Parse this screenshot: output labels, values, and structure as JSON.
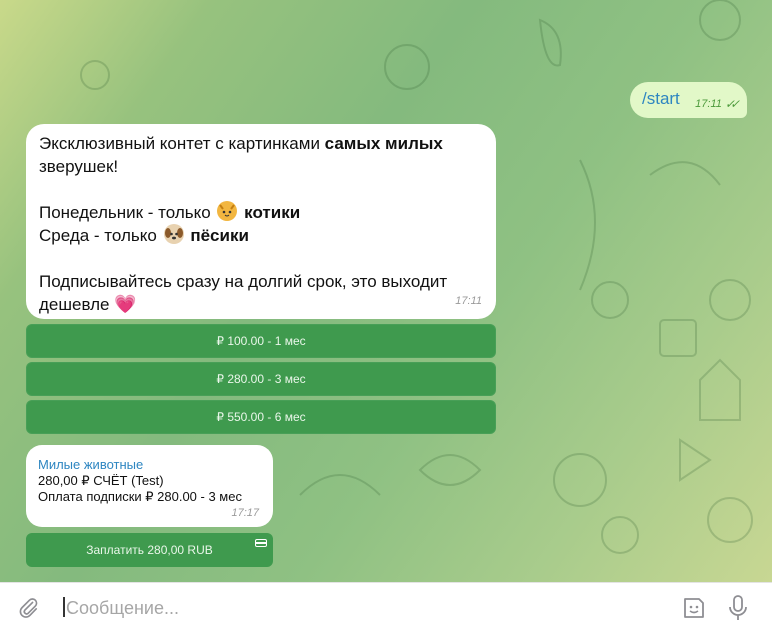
{
  "chat": {
    "outgoing": {
      "text": "/start",
      "time": "17:11"
    },
    "welcome": {
      "line1_normal": "Эксклюзивный контет с картинками ",
      "line1_bold": "самых милых",
      "line2": "зверушек!",
      "monday_prefix": "Понедельник - только",
      "monday_bold": "котики",
      "wednesday_prefix": "Среда - только",
      "wednesday_bold": "пёсики",
      "line_subscribe": "Подписывайтесь сразу на долгий срок, это выходит",
      "line_subscribe_end": "дешевле",
      "time": "17:11"
    },
    "buttons": [
      {
        "label": "₽ 100.00 - 1 мес"
      },
      {
        "label": "₽ 280.00 - 3 мес"
      },
      {
        "label": "₽ 550.00 - 6 мес"
      }
    ],
    "invoice": {
      "title": "Милые животные",
      "amount": "280,00 ₽ СЧЁТ (Test)",
      "description": "Оплата подписки ₽ 280.00 - 3 мес",
      "time": "17:17",
      "pay_label": "Заплатить 280,00 RUB"
    }
  },
  "composer": {
    "placeholder": "Сообщение..."
  },
  "icons": {
    "attach": "paperclip-icon",
    "sticker": "sticker-icon",
    "mic": "microphone-icon",
    "read": "double-check-icon",
    "card": "credit-card-icon"
  },
  "colors": {
    "button_green": "#3f9a4e",
    "outgoing_bubble": "#e2f8c8",
    "link_blue": "#2e86c1"
  }
}
